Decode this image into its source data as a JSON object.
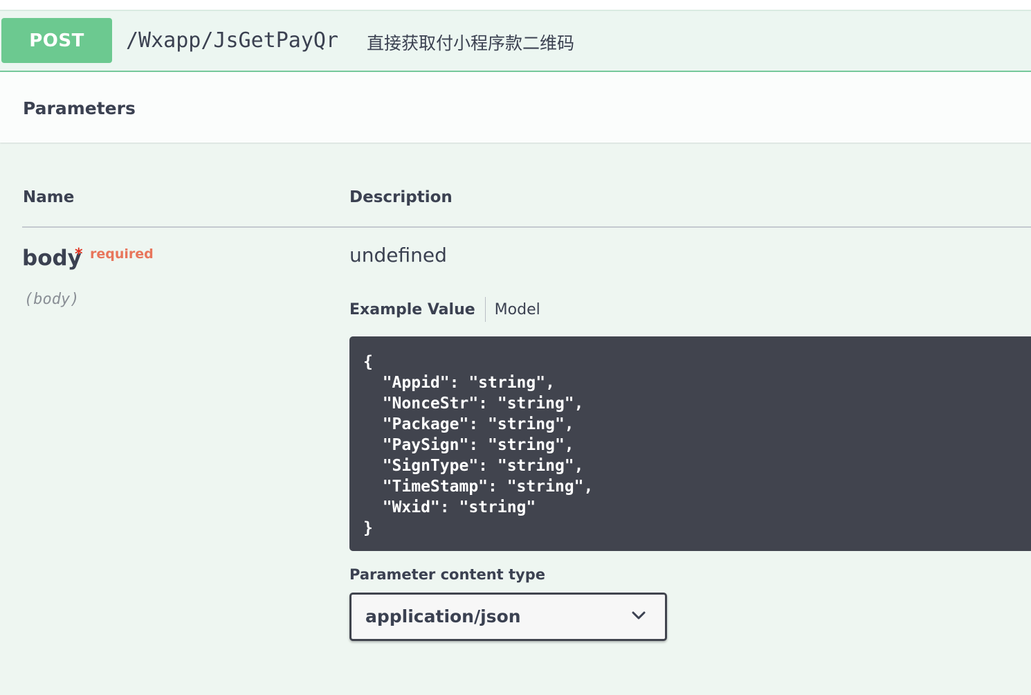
{
  "operation": {
    "method": "POST",
    "path": "/Wxapp/JsGetPayQr",
    "description": "直接获取付小程序款二维码"
  },
  "parameters": {
    "title": "Parameters",
    "columns": {
      "name": "Name",
      "description": "Description"
    },
    "rows": [
      {
        "name": "body",
        "required_star": "*",
        "required_label": "required",
        "in": "(body)",
        "description": "undefined",
        "tabs": {
          "example": "Example Value",
          "model": "Model"
        },
        "example_code": "{\n  \"Appid\": \"string\",\n  \"NonceStr\": \"string\",\n  \"Package\": \"string\",\n  \"PaySign\": \"string\",\n  \"SignType\": \"string\",\n  \"TimeStamp\": \"string\",\n  \"Wxid\": \"string\"\n}",
        "content_type_label": "Parameter content type",
        "content_type_value": "application/json"
      }
    ]
  },
  "colors": {
    "post_badge": "#6cc990",
    "post_border": "#76c99c",
    "required": "#e0301e",
    "code_bg": "#41444e"
  },
  "icons": {
    "select_chevron": "chevron-down-icon"
  }
}
